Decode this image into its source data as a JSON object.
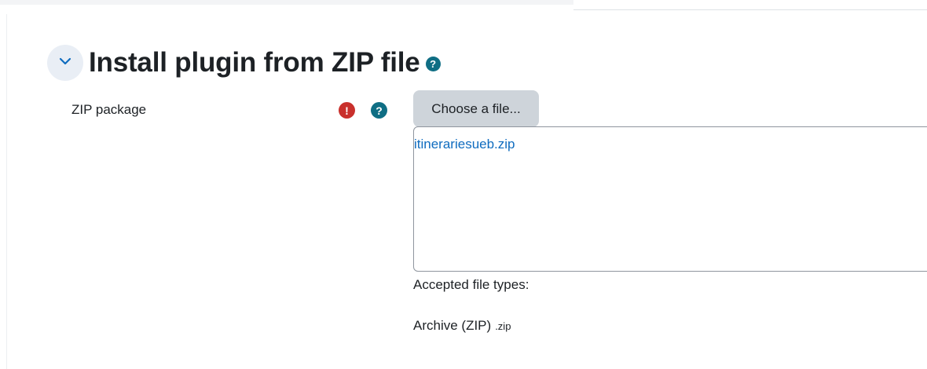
{
  "section": {
    "title": "Install plugin from ZIP file",
    "help_glyph": "?",
    "toggle_icon": "chevron-down-icon"
  },
  "field": {
    "label": "ZIP package",
    "required_glyph": "!",
    "help_glyph": "?"
  },
  "filepicker": {
    "choose_label": "Choose a file...",
    "selected_file": "itinerariesueb.zip"
  },
  "accepted": {
    "label": "Accepted file types:",
    "types": [
      {
        "name": "Archive (ZIP)",
        "ext": ".zip"
      }
    ]
  },
  "colors": {
    "help_icon": "#0f6e84",
    "required_icon": "#c9302c",
    "link": "#0f6cbf",
    "button_bg": "#ced4da",
    "toggle_bg": "#e9eef5"
  }
}
